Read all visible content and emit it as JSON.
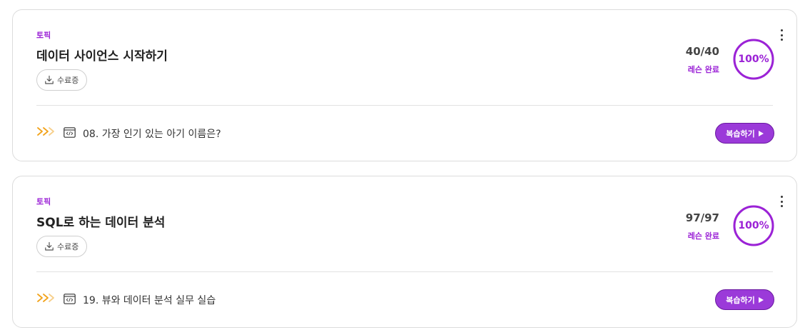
{
  "courses": [
    {
      "topic_tag": "토픽",
      "title": "데이터 사이언스 시작하기",
      "certificate_label": "수료증",
      "lesson_count": "40/40",
      "lesson_status": "레슨 완료",
      "progress_label": "100%",
      "progress_fraction": 1.0,
      "last_lesson": "08. 가장 인기 있는 아기 이름은?",
      "review_label": "복습하기"
    },
    {
      "topic_tag": "토픽",
      "title": "SQL로 하는 데이터 분석",
      "certificate_label": "수료증",
      "lesson_count": "97/97",
      "lesson_status": "레슨 완료",
      "progress_label": "100%",
      "progress_fraction": 1.0,
      "last_lesson": "19. 뷰와 데이터 분석 실무 실습",
      "review_label": "복습하기"
    }
  ],
  "colors": {
    "accent": "#9b22d6",
    "button": "#9b3ad9",
    "chevron_orange": "#f2a31b",
    "chevron_light": "#f7cf8a"
  },
  "icons": {
    "certificate": "download-icon",
    "lesson": "code-window-icon",
    "more": "more-vertical-icon",
    "review": "play-icon",
    "progress": "chevrons-right-icon"
  }
}
